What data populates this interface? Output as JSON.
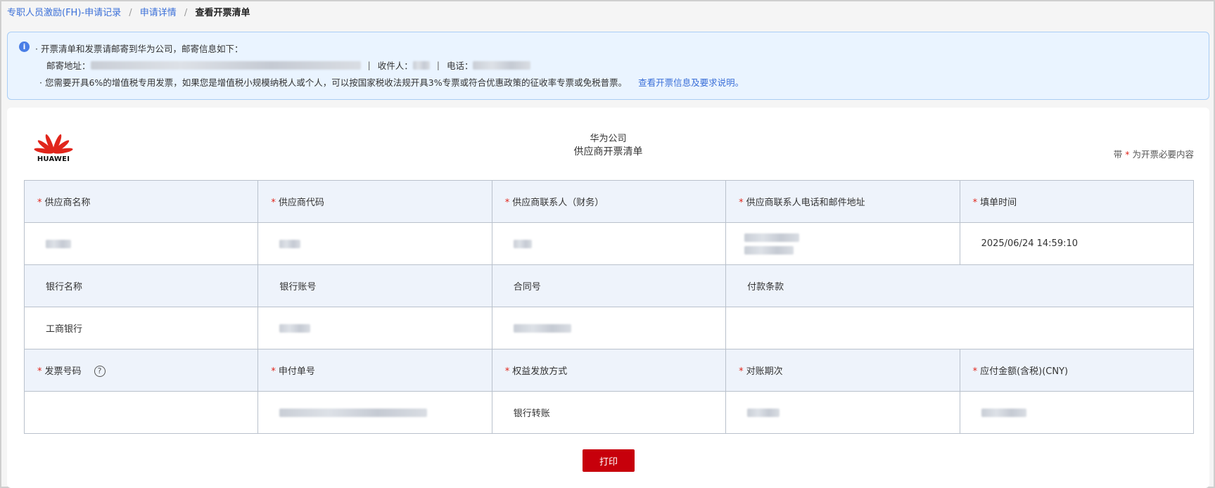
{
  "breadcrumb": {
    "item1": "专职人员激励(FH)-申请记录",
    "item2": "申请详情",
    "current": "查看开票清单",
    "sep": "/"
  },
  "notice": {
    "line1": "· 开票清单和发票请邮寄到华为公司，邮寄信息如下：",
    "address_label": "邮寄地址：",
    "recipient_label": "收件人：",
    "phone_label": "电话：",
    "pipe": "|",
    "line3": "· 您需要开具6%的增值税专用发票，如果您是增值税小规模纳税人或个人，可以按国家税收法规开具3%专票或符合优惠政策的征收率专票或免税普票。",
    "link": "查看开票信息及要求说明。"
  },
  "card": {
    "logo_text": "HUAWEI",
    "title1": "华为公司",
    "title2": "供应商开票清单",
    "required_note_prefix": "带",
    "required_note_star": "*",
    "required_note_suffix": "为开票必要内容"
  },
  "table": {
    "row1_headers": [
      "供应商名称",
      "供应商代码",
      "供应商联系人（财务）",
      "供应商联系人电话和邮件地址",
      "填单时间"
    ],
    "fill_time": "2025/06/24 14:59:10",
    "row3_headers": [
      "银行名称",
      "银行账号",
      "合同号",
      "付款条款"
    ],
    "bank_name": "工商银行",
    "row5_headers": [
      "发票号码",
      "申付单号",
      "权益发放方式",
      "对账期次",
      "应付金额(含税)(CNY)"
    ],
    "payment_method": "银行转账",
    "star": "*",
    "help": "?"
  },
  "actions": {
    "print": "打印"
  },
  "colors": {
    "brand_red": "#c7000b",
    "link_blue": "#3a6fd8",
    "notice_bg": "#eaf4ff",
    "header_bg": "#eef3fb"
  }
}
